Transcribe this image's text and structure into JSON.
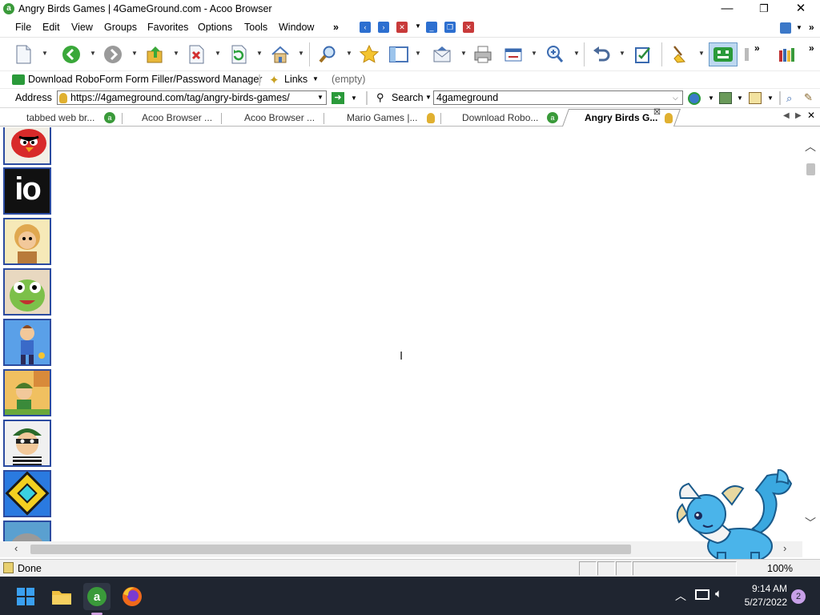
{
  "window": {
    "title": "Angry Birds Games | 4GameGround.com - Acoo Browser",
    "app_icon_letter": "a",
    "controls": {
      "minimize": "—",
      "maximize": "❐",
      "close": "✕"
    }
  },
  "menu": {
    "items": [
      "File",
      "Edit",
      "View",
      "Groups",
      "Favorites",
      "Options",
      "Tools",
      "Window"
    ],
    "overflow": "»"
  },
  "links_bar": {
    "roboform_label": "Download RoboForm Form Filler/Password Manager",
    "links_label": "Links",
    "empty_label": "(empty)"
  },
  "address_bar": {
    "label": "Address",
    "url": "https://4gameground.com/tag/angry-birds-games/",
    "search_label": "Search",
    "search_value": "4gameground"
  },
  "tabs": [
    {
      "label": "tabbed web br..."
    },
    {
      "label": "Acoo Browser ..."
    },
    {
      "label": "Acoo Browser ..."
    },
    {
      "label": "Mario Games |..."
    },
    {
      "label": "Download Robo..."
    },
    {
      "label": "Angry Birds G...",
      "active": true
    }
  ],
  "thumbnails": [
    {
      "name": "angry-birds",
      "color": "#b22a2a"
    },
    {
      "name": "io-games",
      "color": "#7b2a8a",
      "text": "io"
    },
    {
      "name": "adam-and-eve",
      "color": "#caa35a"
    },
    {
      "name": "cut-the-rope",
      "color": "#6ba83a"
    },
    {
      "name": "subway-runner",
      "color": "#3a7fc8"
    },
    {
      "name": "adventure-boy",
      "color": "#d98a2a"
    },
    {
      "name": "bob-the-robber",
      "color": "#3a7a3a"
    },
    {
      "name": "geometry-dash",
      "color": "#1f6fcf"
    },
    {
      "name": "talking-tom",
      "color": "#9c8a5a"
    }
  ],
  "status": {
    "text": "Done",
    "zoom": "100%"
  },
  "taskbar": {
    "time": "9:14 AM",
    "date": "5/27/2022",
    "notification_count": "2"
  },
  "colors": {
    "accent": "#2b4ba0",
    "taskbar": "#1f2530",
    "acoo_green": "#3a9a3a"
  }
}
